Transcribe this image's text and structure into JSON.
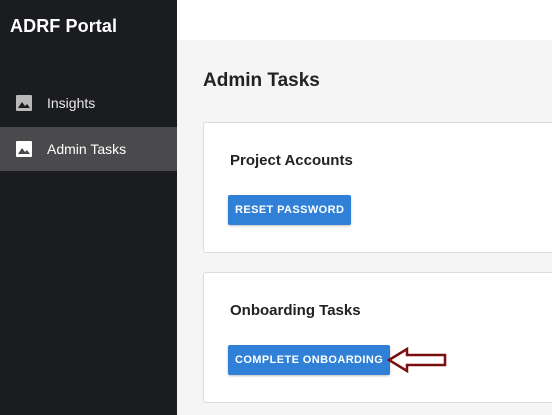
{
  "app": {
    "title": "ADRF Portal"
  },
  "sidebar": {
    "items": [
      {
        "label": "Insights",
        "icon": "image-icon",
        "active": false
      },
      {
        "label": "Admin Tasks",
        "icon": "image-icon",
        "active": true
      }
    ]
  },
  "main": {
    "title": "Admin Tasks",
    "cards": [
      {
        "title": "Project Accounts",
        "button_label": "RESET PASSWORD"
      },
      {
        "title": "Onboarding Tasks",
        "button_label": "COMPLETE ONBOARDING"
      }
    ]
  },
  "annotation": {
    "arrow_icon": "left-arrow-outline-icon",
    "arrow_color": "#7a0f12"
  },
  "colors": {
    "sidebar_bg": "#1b1c20",
    "sidebar_active_bg": "#4a4a4c",
    "button_bg": "#2f80d6",
    "page_bg": "#f5f5f5"
  }
}
